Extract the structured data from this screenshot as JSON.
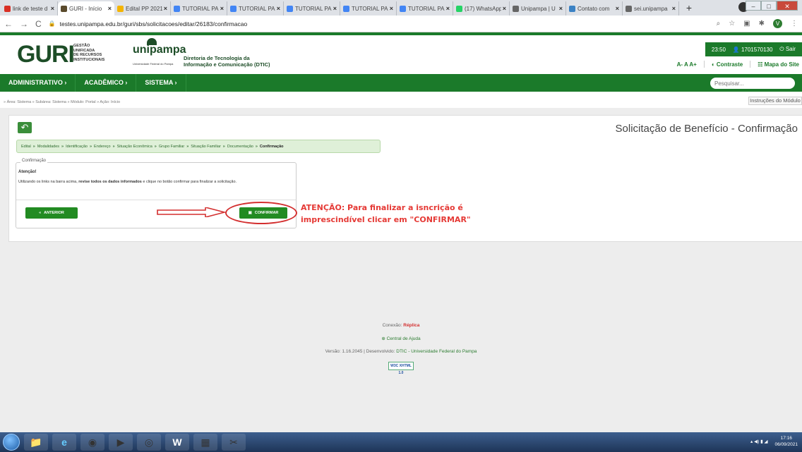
{
  "browser": {
    "tabs": [
      {
        "label": "link de teste d",
        "color": "#d93025"
      },
      {
        "label": "GURI - Início",
        "color": "#5a4a2c",
        "active": true
      },
      {
        "label": "Edital PP 2021",
        "color": "#f4b400"
      },
      {
        "label": "TUTORIAL PA",
        "color": "#4285f4"
      },
      {
        "label": "TUTORIAL PA",
        "color": "#4285f4"
      },
      {
        "label": "TUTORIAL PA",
        "color": "#4285f4"
      },
      {
        "label": "TUTORIAL PA",
        "color": "#4285f4"
      },
      {
        "label": "TUTORIAL PA",
        "color": "#4285f4"
      },
      {
        "label": "(17) WhatsApp",
        "color": "#25d366"
      },
      {
        "label": "Unipampa | U",
        "color": "#666666"
      },
      {
        "label": "Contato com",
        "color": "#3b82c4"
      },
      {
        "label": "sei.unipampa",
        "color": "#666666"
      }
    ],
    "url": "testes.unipampa.edu.br/guri/sbs/solicitacoes/editar/26183/confirmacao",
    "profile_initial": "V"
  },
  "header": {
    "guri": "GURI",
    "guri_sub": [
      "GESTÃO",
      "UNIFICADA",
      "DE RECURSOS",
      "INSTITUCIONAIS"
    ],
    "unipampa": "unipampa",
    "unipampa_small": "Universidade Federal do Pampa",
    "dtic_line1": "Diretoria de Tecnologia da",
    "dtic_line2": "Informação e Comunicação (DTIC)",
    "time": "23:50",
    "user": "1701570130",
    "logout": "Sair",
    "font_sizes": "A- A A+",
    "contrast": "Contraste",
    "sitemap": "Mapa do Site"
  },
  "menu": [
    "ADMINISTRATIVO ›",
    "ACADÊMICO ›",
    "SISTEMA ›"
  ],
  "search_placeholder": "Pesquisar...",
  "breadcrumb": "» Área: Sistema » Subárea: Sistema » Módulo: Portal » Ação: Início",
  "instructions": "Instruções do Módulo",
  "page_title": "Solicitação de Benefício - Confirmação",
  "steps": [
    "Edital",
    "Modalidades",
    "Identificação",
    "Endereço",
    "Situação Econômica",
    "Grupo Familiar",
    "Situação Familiar",
    "Documentação",
    "Confirmação"
  ],
  "fieldset": {
    "legend": "Confirmação",
    "title": "Atenção!",
    "text_before": "Utilizando os links na barra acima, ",
    "text_bold": "revise todos os dados informados",
    "text_after": " e clique no botão confirmar para finalizar a solicitação."
  },
  "buttons": {
    "previous": "ANTERIOR",
    "confirm": "CONFIRMAR"
  },
  "warning": {
    "line1": "ATENÇÃO: Para finalizar a isncrição é",
    "line2": "imprescindível clicar em \"CONFIRMAR\""
  },
  "footer": {
    "connection_label": "Conexão: ",
    "connection_value": "Réplica",
    "help": "Central de Ajuda",
    "version_prefix": "Versão: 1.16.2045 | Desenvolvido: ",
    "version_link": "DTIC - Universidade Federal do Pampa",
    "w3c": "W3C XHTML 1.0"
  },
  "taskbar": {
    "time": "17:16",
    "date": "06/09/2021"
  }
}
